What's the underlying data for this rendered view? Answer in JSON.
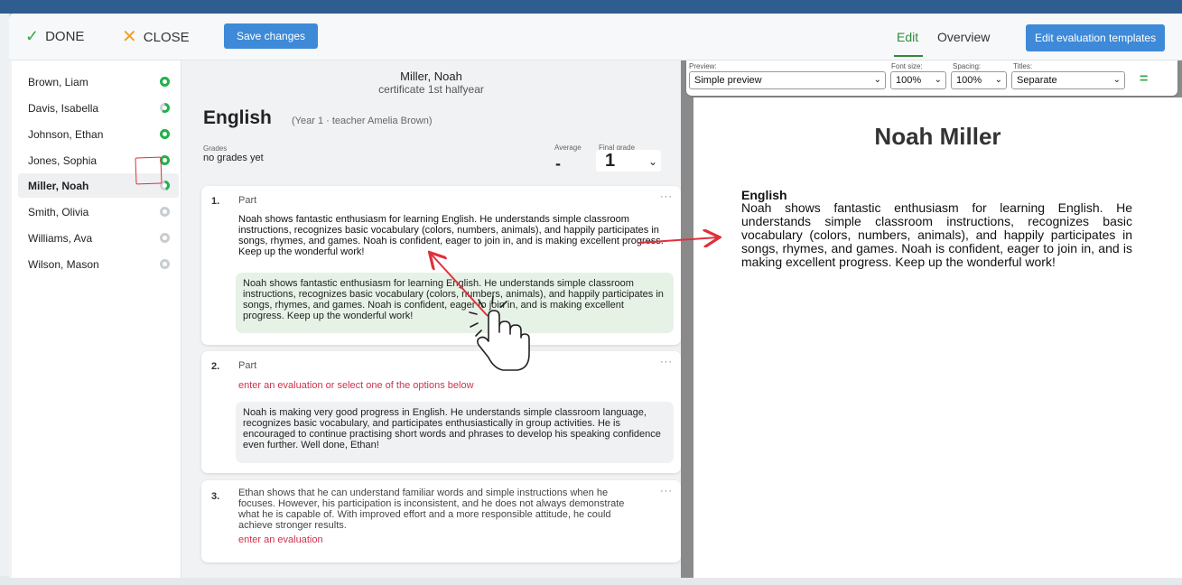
{
  "header": {
    "done_label": "DONE",
    "close_label": "CLOSE",
    "save_label": "Save changes",
    "tab_edit": "Edit",
    "tab_overview": "Overview",
    "templates_label": "Edit evaluation templates"
  },
  "students": [
    {
      "name": "Brown, Liam",
      "status": "full"
    },
    {
      "name": "Davis, Isabella",
      "status": "partial"
    },
    {
      "name": "Johnson, Ethan",
      "status": "full"
    },
    {
      "name": "Jones, Sophia",
      "status": "full"
    },
    {
      "name": "Miller, Noah",
      "status": "partial",
      "selected": true
    },
    {
      "name": "Smith, Olivia",
      "status": "empty"
    },
    {
      "name": "Williams, Ava",
      "status": "empty"
    },
    {
      "name": "Wilson, Mason",
      "status": "empty"
    }
  ],
  "detail": {
    "student": "Miller, Noah",
    "certificate": "certificate 1st halfyear",
    "subject": "English",
    "subject_meta": "(Year 1 · teacher Amelia Brown)",
    "grades_label": "Grades",
    "grades_value": "no grades yet",
    "average_label": "Average",
    "average_value": "-",
    "final_label": "Final grade",
    "final_value": "1"
  },
  "parts": [
    {
      "number": "1.",
      "title": "Part",
      "text": "Noah shows fantastic enthusiasm for learning English. He understands simple classroom instructions, recognizes basic vocabulary (colors, numbers, animals), and happily participates in songs, rhymes, and games. Noah is confident, eager to join in, and is making excellent progress. Keep up the wonderful work!",
      "option": "Noah shows fantastic enthusiasm for learning English. He understands simple classroom instructions, recognizes basic vocabulary (colors, numbers, animals), and happily participates in songs, rhymes, and games. Noah is confident, eager to join in, and is making excellent progress. Keep up the wonderful work!"
    },
    {
      "number": "2.",
      "title": "Part",
      "prompt": "enter an evaluation or select one of the options below",
      "option": "Noah is making very good progress in English. He understands simple classroom language, recognizes basic vocabulary, and participates enthusiastically in group activities. He is encouraged to continue practising short words and phrases to develop his speaking confidence even further. Well done, Ethan!"
    },
    {
      "number": "3.",
      "text": "Ethan shows that he can understand familiar words and simple instructions when he focuses. However, his participation is inconsistent, and he does not always demonstrate what he is capable of. With improved effort and a more responsible attitude, he could achieve stronger results.",
      "prompt": "enter an evaluation"
    }
  ],
  "preview_toolbar": {
    "preview_label": "Preview:",
    "preview_value": "Simple preview",
    "font_label": "Font size:",
    "font_value": "100%",
    "spacing_label": "Spacing:",
    "spacing_value": "100%",
    "titles_label": "Titles:",
    "titles_value": "Separate"
  },
  "preview": {
    "title": "Noah Miller",
    "subject": "English",
    "body": "Noah shows fantastic enthusiasm for learning English. He understands simple classroom instructions, recognizes basic vocabulary (colors, numbers, animals), and happily participates in songs, rhymes, and games. Noah is confident, eager to join in, and is making excellent progress. Keep up the wonderful work!"
  },
  "colors": {
    "accent_blue": "#3e8ad8",
    "green": "#21b14a",
    "prompt_red": "#d0314a",
    "annotation_red": "#e0303a"
  }
}
